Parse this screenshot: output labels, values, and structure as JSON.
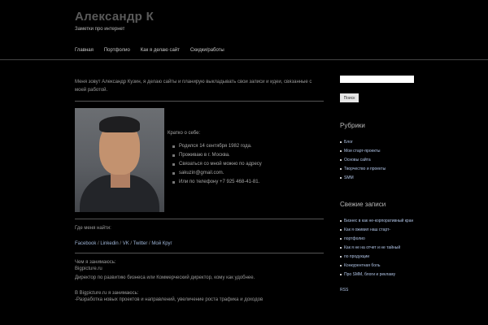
{
  "site": {
    "title": "Александр К",
    "description": "Заметки про интернет"
  },
  "nav": {
    "items": [
      "Главная",
      "Портфолио",
      "Как я делаю сайт",
      "Скидки/работы"
    ]
  },
  "content": {
    "intro": "Меня зовут Александр Кузин, я делаю сайты и планирую выкладывать свои записи и идеи, связанные с моей работой.",
    "bio_heading": "Кратко о себе:",
    "bio_items": [
      "Родился 14 сентября 1982 года.",
      "Проживаю в г. Москва.",
      "Связаться со мной можно по адресу",
      "sakuzin@gmail.com.",
      "Или по телефону +7 925 468-41-81."
    ],
    "social_title": "Где меня найти:",
    "social_links": [
      "Facebook",
      "Linkedin",
      "VK",
      "Twitter",
      "Мой Круг"
    ],
    "social_sep": " / ",
    "work_title": "Чем я занимаюсь:",
    "work_lines": [
      "Bigpicture.ru",
      "Директор по развитию бизнеса или Коммерческий директор, кому как удобнее."
    ],
    "work2_title": "В Bigpicture.ru я занимаюсь:",
    "work2_lines": [
      "-Разработка новых проектов и направлений, увеличение роста трафика и доходов"
    ]
  },
  "sidebar": {
    "search_button_label": "Поиск",
    "categories_title": "Рубрики",
    "categories": [
      "Блог",
      "Мои старт-проекты",
      "Основы сайта",
      "Творчество и проекты",
      "SMM"
    ],
    "recent_title": "Свежие записи",
    "recent_posts": [
      "Бизнес в как не-корпоративный кран",
      "Как я оживил наш старт-",
      "портфолио",
      "Как я не на отчет и не тайный",
      "по продукции",
      "Конкурентная боль",
      "Про SMM, блоги и рекламу"
    ],
    "meta_link": "RSS"
  }
}
